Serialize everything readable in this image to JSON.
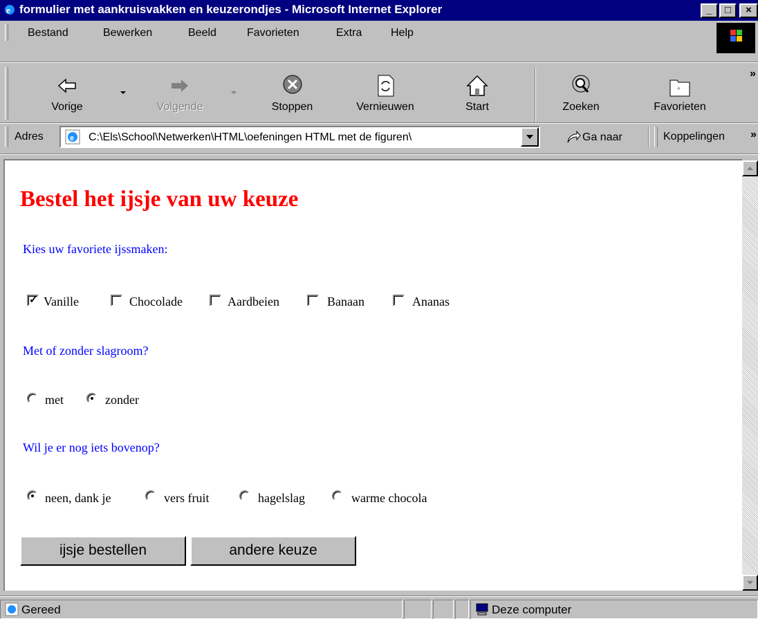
{
  "window": {
    "title": "formulier met aankruisvakken en keuzerondjes - Microsoft Internet Explorer",
    "minimize": "_",
    "maximize": "□",
    "close": "×"
  },
  "menu": {
    "items": [
      {
        "label": "Bestand"
      },
      {
        "label": "Bewerken"
      },
      {
        "label": "Beeld"
      },
      {
        "label": "Favorieten"
      },
      {
        "label": "Extra"
      },
      {
        "label": "Help"
      }
    ]
  },
  "toolbar": {
    "back": "Vorige",
    "forward": "Volgende",
    "stop": "Stoppen",
    "refresh": "Vernieuwen",
    "home": "Start",
    "search": "Zoeken",
    "favorites": "Favorieten",
    "more": "»"
  },
  "address": {
    "label": "Adres",
    "value": "C:\\Els\\School\\Netwerken\\HTML\\oefeningen HTML met de figuren\\",
    "go": "Ga naar",
    "links": "Koppelingen",
    "more": "»"
  },
  "page": {
    "heading": "Bestel het ijsje van uw keuze",
    "flavors_label": "Kies uw favoriete ijssmaken:",
    "flavors": [
      {
        "label": "Vanille",
        "checked": true
      },
      {
        "label": "Chocolade",
        "checked": false
      },
      {
        "label": "Aardbeien",
        "checked": false
      },
      {
        "label": "Banaan",
        "checked": false
      },
      {
        "label": "Ananas",
        "checked": false
      }
    ],
    "cream_label": "Met of zonder slagroom?",
    "cream": [
      {
        "label": "met",
        "checked": false
      },
      {
        "label": "zonder",
        "checked": true
      }
    ],
    "topping_label": "Wil je er nog iets bovenop?",
    "toppings": [
      {
        "label": "neen, dank je",
        "checked": true
      },
      {
        "label": "vers fruit",
        "checked": false
      },
      {
        "label": "hagelslag",
        "checked": false
      },
      {
        "label": "warme chocola",
        "checked": false
      }
    ],
    "submit": "ijsje bestellen",
    "reset": "andere keuze"
  },
  "status": {
    "text": "Gereed",
    "zone": "Deze computer"
  }
}
